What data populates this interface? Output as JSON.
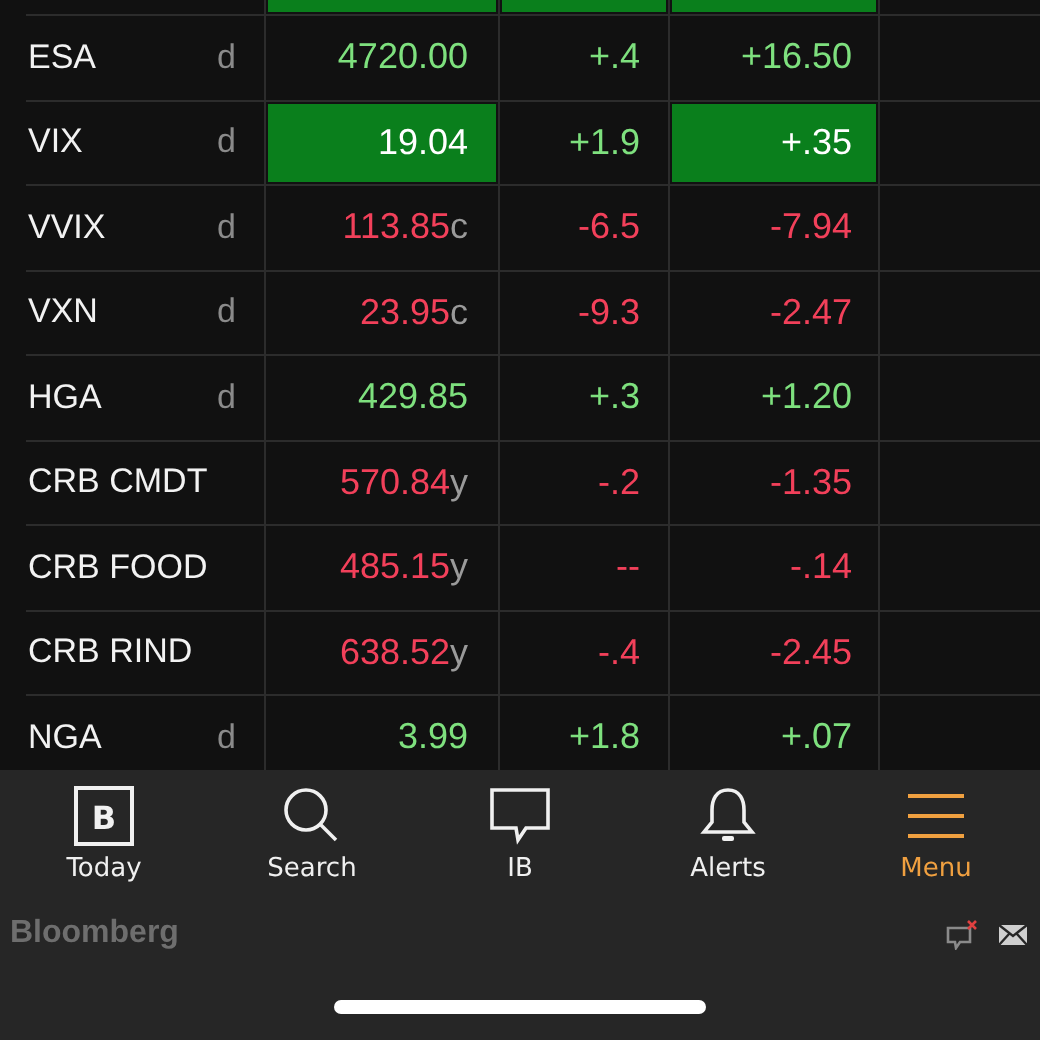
{
  "quotes": {
    "rows": [
      {
        "kind": "partial",
        "price_highlight": true,
        "change_highlight": true,
        "net_highlight": true
      },
      {
        "kind": "quote",
        "name": "ESA",
        "flag": "d",
        "price": "4720.00",
        "rising": true,
        "change": "+.4",
        "net": "+16.50",
        "price_highlight": false,
        "change_highlight": false,
        "net_highlight": false
      },
      {
        "kind": "quote",
        "name": "VIX",
        "flag": "d",
        "price": "19.04",
        "rising": true,
        "change": "+1.9",
        "net": "+.35",
        "price_highlight": true,
        "change_highlight": false,
        "net_highlight": true
      },
      {
        "kind": "quote",
        "name": "VVIX",
        "flag": "d",
        "price": "113.85",
        "suffix": "c",
        "rising": false,
        "change": "-6.5",
        "net": "-7.94",
        "price_highlight": false,
        "change_highlight": false,
        "net_highlight": false
      },
      {
        "kind": "quote",
        "name": "VXN",
        "flag": "d",
        "price": "23.95",
        "suffix": "c",
        "rising": false,
        "change": "-9.3",
        "net": "-2.47",
        "price_highlight": false,
        "change_highlight": false,
        "net_highlight": false
      },
      {
        "kind": "quote",
        "name": "HGA",
        "flag": "d",
        "price": "429.85",
        "rising": true,
        "change": "+.3",
        "net": "+1.20",
        "price_highlight": false,
        "change_highlight": false,
        "net_highlight": false
      },
      {
        "kind": "quote",
        "name": "CRB CMDT",
        "price": "570.84",
        "suffix": "y",
        "rising": false,
        "change": "-.2",
        "net": "-1.35",
        "price_highlight": false,
        "change_highlight": false,
        "net_highlight": false
      },
      {
        "kind": "quote",
        "name": "CRB FOOD",
        "price": "485.15",
        "suffix": "y",
        "rising": false,
        "change": "--",
        "net": "-.14",
        "price_highlight": false,
        "change_highlight": false,
        "net_highlight": false
      },
      {
        "kind": "quote",
        "name": "CRB RIND",
        "price": "638.52",
        "suffix": "y",
        "rising": false,
        "change": "-.4",
        "net": "-2.45",
        "price_highlight": false,
        "change_highlight": false,
        "net_highlight": false
      },
      {
        "kind": "quote",
        "name": "NGA",
        "flag": "d",
        "price": "3.99",
        "rising": true,
        "change": "+1.8",
        "net": "+.07",
        "price_highlight": false,
        "change_highlight": false,
        "net_highlight": false
      }
    ]
  },
  "tab_bar": [
    {
      "kind": "today",
      "label": "Today",
      "glyph": "B",
      "selected": false
    },
    {
      "kind": "search",
      "label": "Search",
      "selected": false
    },
    {
      "kind": "ib",
      "label": "IB",
      "selected": false
    },
    {
      "kind": "alerts",
      "label": "Alerts",
      "selected": false
    },
    {
      "kind": "menu",
      "label": "Menu",
      "selected": true
    }
  ],
  "footer": {
    "brand": "Bloomberg"
  }
}
